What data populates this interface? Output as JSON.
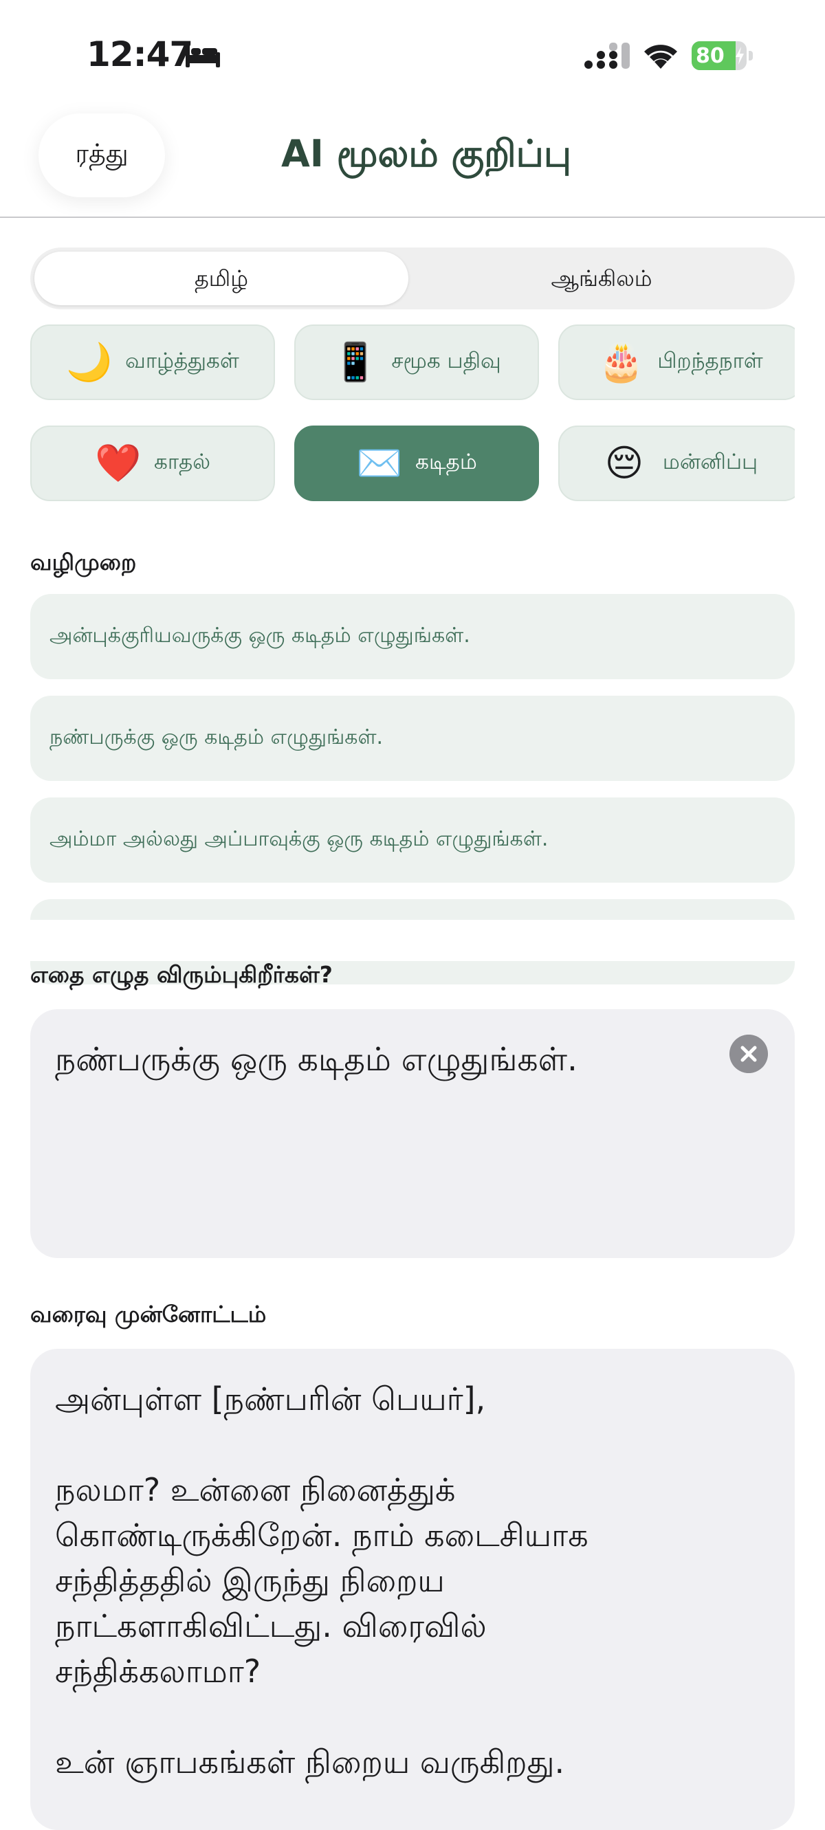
{
  "status_bar": {
    "time": "12:47",
    "battery": "80",
    "battery_level": 0.8,
    "icons": [
      "bed-icon",
      "signal-icon",
      "wifi-icon",
      "battery-icon"
    ]
  },
  "header": {
    "back_label": "ரத்து",
    "title": "AI மூலம் குறிப்பு"
  },
  "language_tabs": {
    "selected": "தமிழ்",
    "items": [
      "தமிழ்",
      "ஆங்கிலம்"
    ]
  },
  "categories": [
    {
      "emoji": "🌙",
      "label": "வாழ்த்துகள்",
      "icon": "moon-icon",
      "active": false
    },
    {
      "emoji": "📱",
      "label": "சமூக பதிவு",
      "icon": "phone-icon",
      "active": false
    },
    {
      "emoji": "🎂",
      "label": "பிறந்தநாள்",
      "icon": "cake-icon",
      "active": false
    },
    {
      "emoji": "❤️",
      "label": "காதல்",
      "icon": "heart-icon",
      "active": false
    },
    {
      "emoji": "✉️",
      "label": "கடிதம்",
      "icon": "envelope-icon",
      "active": true
    },
    {
      "emoji": "😔",
      "label": "மன்னிப்பு",
      "icon": "pensive-face-icon",
      "active": false
    }
  ],
  "guide": {
    "title": "வழிமுறை",
    "suggestions": [
      "அன்புக்குரியவருக்கு ஒரு கடிதம் எழுதுங்கள்.",
      "நண்பருக்கு ஒரு கடிதம் எழுதுங்கள்.",
      "அம்மா அல்லது அப்பாவுக்கு ஒரு கடிதம் எழுதுங்கள்."
    ]
  },
  "prompt": {
    "title": "எதை எழுத விரும்புகிறீர்கள்?",
    "value": "நண்பருக்கு ஒரு கடிதம் எழுதுங்கள்."
  },
  "preview": {
    "title": "வரைவு முன்னோட்டம்",
    "greeting": "அன்புள்ள [நண்பரின் பெயர்],",
    "line1": "நலமா? உன்னை நினைத்துக்",
    "line2": "கொண்டிருக்கிறேன். நாம் கடைசியாக",
    "line3": "சந்தித்ததில் இருந்து நிறைய",
    "line4": "நாட்களாகிவிட்டது. விரைவில்",
    "line5": "சந்திக்கலாமா?",
    "line6": "உன் ஞாபகங்கள் நிறைய வருகிறது."
  },
  "colors": {
    "accent": "#4e836a",
    "chip_bg": "#e8efeb",
    "chip_text": "#3f6e58",
    "title": "#2e4a3c"
  }
}
